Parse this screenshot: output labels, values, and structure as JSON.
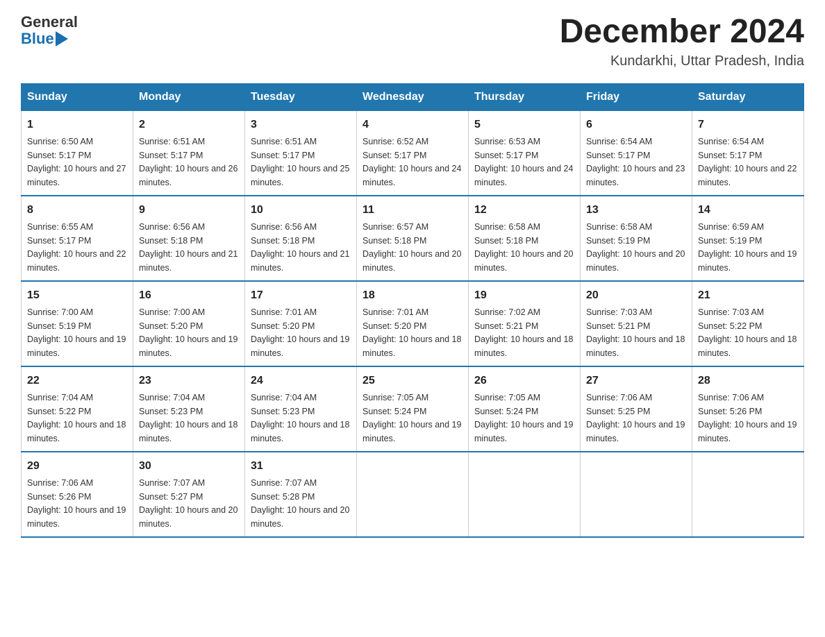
{
  "header": {
    "logo_general": "General",
    "logo_blue": "Blue",
    "title": "December 2024",
    "subtitle": "Kundarkhi, Uttar Pradesh, India"
  },
  "weekdays": [
    "Sunday",
    "Monday",
    "Tuesday",
    "Wednesday",
    "Thursday",
    "Friday",
    "Saturday"
  ],
  "weeks": [
    [
      {
        "day": "1",
        "sunrise": "6:50 AM",
        "sunset": "5:17 PM",
        "daylight": "10 hours and 27 minutes."
      },
      {
        "day": "2",
        "sunrise": "6:51 AM",
        "sunset": "5:17 PM",
        "daylight": "10 hours and 26 minutes."
      },
      {
        "day": "3",
        "sunrise": "6:51 AM",
        "sunset": "5:17 PM",
        "daylight": "10 hours and 25 minutes."
      },
      {
        "day": "4",
        "sunrise": "6:52 AM",
        "sunset": "5:17 PM",
        "daylight": "10 hours and 24 minutes."
      },
      {
        "day": "5",
        "sunrise": "6:53 AM",
        "sunset": "5:17 PM",
        "daylight": "10 hours and 24 minutes."
      },
      {
        "day": "6",
        "sunrise": "6:54 AM",
        "sunset": "5:17 PM",
        "daylight": "10 hours and 23 minutes."
      },
      {
        "day": "7",
        "sunrise": "6:54 AM",
        "sunset": "5:17 PM",
        "daylight": "10 hours and 22 minutes."
      }
    ],
    [
      {
        "day": "8",
        "sunrise": "6:55 AM",
        "sunset": "5:17 PM",
        "daylight": "10 hours and 22 minutes."
      },
      {
        "day": "9",
        "sunrise": "6:56 AM",
        "sunset": "5:18 PM",
        "daylight": "10 hours and 21 minutes."
      },
      {
        "day": "10",
        "sunrise": "6:56 AM",
        "sunset": "5:18 PM",
        "daylight": "10 hours and 21 minutes."
      },
      {
        "day": "11",
        "sunrise": "6:57 AM",
        "sunset": "5:18 PM",
        "daylight": "10 hours and 20 minutes."
      },
      {
        "day": "12",
        "sunrise": "6:58 AM",
        "sunset": "5:18 PM",
        "daylight": "10 hours and 20 minutes."
      },
      {
        "day": "13",
        "sunrise": "6:58 AM",
        "sunset": "5:19 PM",
        "daylight": "10 hours and 20 minutes."
      },
      {
        "day": "14",
        "sunrise": "6:59 AM",
        "sunset": "5:19 PM",
        "daylight": "10 hours and 19 minutes."
      }
    ],
    [
      {
        "day": "15",
        "sunrise": "7:00 AM",
        "sunset": "5:19 PM",
        "daylight": "10 hours and 19 minutes."
      },
      {
        "day": "16",
        "sunrise": "7:00 AM",
        "sunset": "5:20 PM",
        "daylight": "10 hours and 19 minutes."
      },
      {
        "day": "17",
        "sunrise": "7:01 AM",
        "sunset": "5:20 PM",
        "daylight": "10 hours and 19 minutes."
      },
      {
        "day": "18",
        "sunrise": "7:01 AM",
        "sunset": "5:20 PM",
        "daylight": "10 hours and 18 minutes."
      },
      {
        "day": "19",
        "sunrise": "7:02 AM",
        "sunset": "5:21 PM",
        "daylight": "10 hours and 18 minutes."
      },
      {
        "day": "20",
        "sunrise": "7:03 AM",
        "sunset": "5:21 PM",
        "daylight": "10 hours and 18 minutes."
      },
      {
        "day": "21",
        "sunrise": "7:03 AM",
        "sunset": "5:22 PM",
        "daylight": "10 hours and 18 minutes."
      }
    ],
    [
      {
        "day": "22",
        "sunrise": "7:04 AM",
        "sunset": "5:22 PM",
        "daylight": "10 hours and 18 minutes."
      },
      {
        "day": "23",
        "sunrise": "7:04 AM",
        "sunset": "5:23 PM",
        "daylight": "10 hours and 18 minutes."
      },
      {
        "day": "24",
        "sunrise": "7:04 AM",
        "sunset": "5:23 PM",
        "daylight": "10 hours and 18 minutes."
      },
      {
        "day": "25",
        "sunrise": "7:05 AM",
        "sunset": "5:24 PM",
        "daylight": "10 hours and 19 minutes."
      },
      {
        "day": "26",
        "sunrise": "7:05 AM",
        "sunset": "5:24 PM",
        "daylight": "10 hours and 19 minutes."
      },
      {
        "day": "27",
        "sunrise": "7:06 AM",
        "sunset": "5:25 PM",
        "daylight": "10 hours and 19 minutes."
      },
      {
        "day": "28",
        "sunrise": "7:06 AM",
        "sunset": "5:26 PM",
        "daylight": "10 hours and 19 minutes."
      }
    ],
    [
      {
        "day": "29",
        "sunrise": "7:06 AM",
        "sunset": "5:26 PM",
        "daylight": "10 hours and 19 minutes."
      },
      {
        "day": "30",
        "sunrise": "7:07 AM",
        "sunset": "5:27 PM",
        "daylight": "10 hours and 20 minutes."
      },
      {
        "day": "31",
        "sunrise": "7:07 AM",
        "sunset": "5:28 PM",
        "daylight": "10 hours and 20 minutes."
      },
      null,
      null,
      null,
      null
    ]
  ]
}
